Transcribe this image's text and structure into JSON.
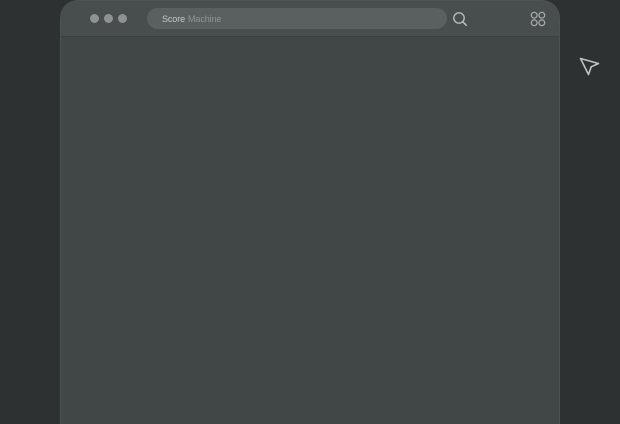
{
  "window": {
    "controls": [
      "dot-1",
      "dot-2",
      "dot-3"
    ]
  },
  "address_bar": {
    "brand_primary": "Score",
    "brand_secondary": "Machine"
  },
  "icons": {
    "search": "search-icon",
    "apps": "apps-grid-icon",
    "cursor": "cursor-arrow-icon"
  },
  "colors": {
    "page_bg": "#2d3131",
    "window_bg": "#414647",
    "titlebar_bg": "#484d4e",
    "address_bg": "#5a5f60"
  }
}
